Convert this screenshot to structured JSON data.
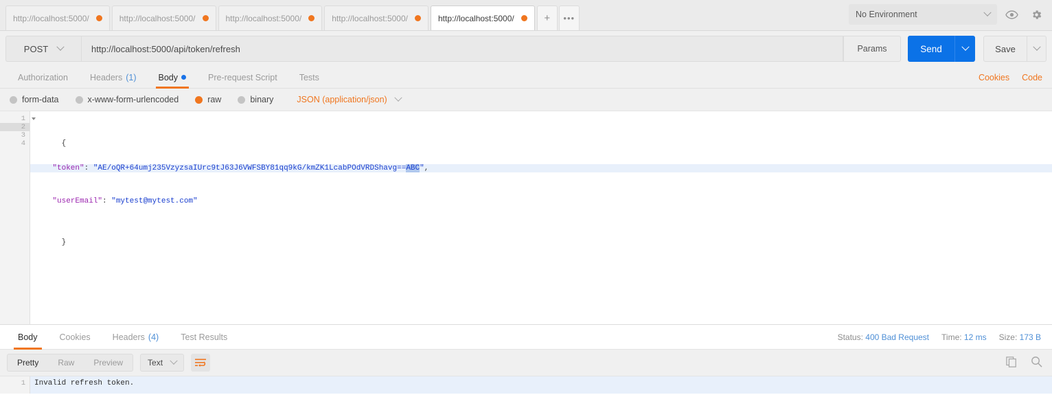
{
  "tabstrip": {
    "tabs": [
      {
        "label": "http://localhost:5000/",
        "active": false
      },
      {
        "label": "http://localhost:5000/",
        "active": false
      },
      {
        "label": "http://localhost:5000/",
        "active": false
      },
      {
        "label": "http://localhost:5000/",
        "active": false
      },
      {
        "label": "http://localhost:5000/",
        "active": true
      }
    ],
    "new_tab_label": "+",
    "more_label": "•••",
    "environment": {
      "selected": "No Environment",
      "eye_icon": "eye-icon",
      "settings_icon": "gear-icon"
    }
  },
  "request": {
    "method": "POST",
    "url": "http://localhost:5000/api/token/refresh",
    "params_label": "Params",
    "send_label": "Send",
    "save_label": "Save"
  },
  "request_tabs": {
    "items": [
      {
        "label": "Authorization",
        "count": "",
        "dot": false,
        "active": false
      },
      {
        "label": "Headers",
        "count": "(1)",
        "dot": false,
        "active": false
      },
      {
        "label": "Body",
        "count": "",
        "dot": true,
        "active": true
      },
      {
        "label": "Pre-request Script",
        "count": "",
        "dot": false,
        "active": false
      },
      {
        "label": "Tests",
        "count": "",
        "dot": false,
        "active": false
      }
    ],
    "cookies_label": "Cookies",
    "code_label": "Code"
  },
  "body_type": {
    "options": [
      {
        "label": "form-data",
        "selected": false
      },
      {
        "label": "x-www-form-urlencoded",
        "selected": false
      },
      {
        "label": "raw",
        "selected": true
      },
      {
        "label": "binary",
        "selected": false
      }
    ],
    "content_type": "JSON (application/json)"
  },
  "editor": {
    "line_numbers": [
      "1",
      "2",
      "3",
      "4"
    ],
    "lines": [
      {
        "text": "{",
        "type": "punct"
      },
      {
        "text": "    \"token\": \"AE/oQR+64umj235VzyzsaIUrc9tJ63J6VWFSBY81qq9kG/kmZK1LcabPOdVRDShavg==ABC\",",
        "type": "kv"
      },
      {
        "text": "    \"userEmail\": \"mytest@mytest.com\"",
        "type": "kv"
      },
      {
        "text": "}",
        "type": "punct"
      }
    ],
    "line2": {
      "indent": "    ",
      "key": "\"token\"",
      "colon": ": ",
      "string_prefix": "\"AE/oQR+64umj235VzyzsaIUrc9tJ63J6VWFSBY81qq9kG/kmZK1LcabPOdVRDShavg==",
      "string_selected": "ABC",
      "string_suffix": "\"",
      "trailing": ","
    },
    "line3": {
      "indent": "    ",
      "key": "\"userEmail\"",
      "colon": ": ",
      "value": "\"mytest@mytest.com\""
    },
    "open_brace": "{",
    "close_brace": "}",
    "highlighted_line": 2
  },
  "response_tabs": {
    "items": [
      {
        "label": "Body",
        "count": "",
        "active": true
      },
      {
        "label": "Cookies",
        "count": "",
        "active": false
      },
      {
        "label": "Headers",
        "count": "(4)",
        "active": false
      },
      {
        "label": "Test Results",
        "count": "",
        "active": false
      }
    ],
    "status": {
      "status_label": "Status:",
      "status_value": "400 Bad Request",
      "time_label": "Time:",
      "time_value": "12 ms",
      "size_label": "Size:",
      "size_value": "173 B"
    }
  },
  "response_toolbar": {
    "views": [
      {
        "label": "Pretty",
        "active": true
      },
      {
        "label": "Raw",
        "active": false
      },
      {
        "label": "Preview",
        "active": false
      }
    ],
    "format": "Text",
    "wrap_icon": "word-wrap-icon",
    "copy_icon": "copy-icon",
    "search_icon": "search-icon"
  },
  "response_body": {
    "line_number": "1",
    "text": "Invalid refresh token."
  },
  "colors": {
    "accent_orange": "#f0761f",
    "link_blue": "#4e8fd6",
    "send_blue": "#0b72e7",
    "json_string": "#1a3fcf",
    "json_key": "#9c27b0"
  }
}
